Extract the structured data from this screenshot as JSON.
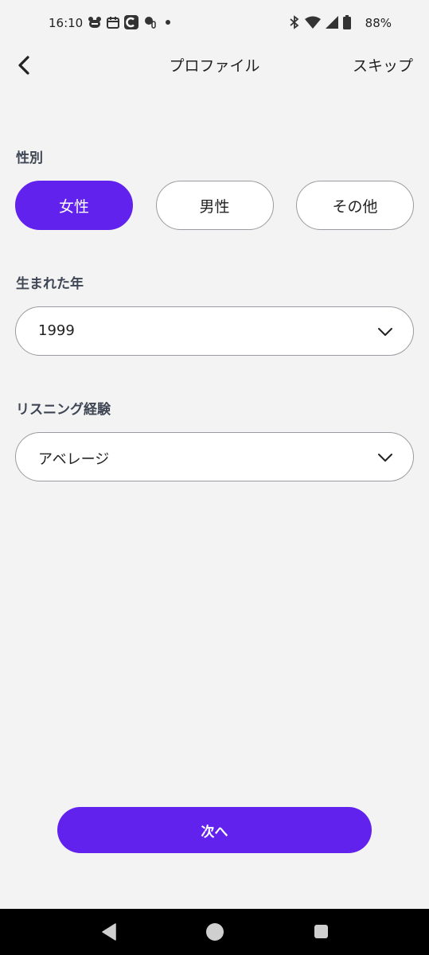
{
  "status_bar": {
    "time": "16:10",
    "battery": "88%",
    "left_icons": [
      "app-notification-icon",
      "calendar-icon",
      "c-app-icon",
      "accessibility-icon",
      "dot-icon"
    ],
    "right_icons": [
      "bluetooth-icon",
      "wifi-icon",
      "signal-icon",
      "battery-icon"
    ]
  },
  "header": {
    "back_icon": "back-chevron-icon",
    "title": "プロファイル",
    "skip_label": "スキップ"
  },
  "gender": {
    "label": "性別",
    "options": [
      "女性",
      "男性",
      "その他"
    ],
    "selected": "女性"
  },
  "birth_year": {
    "label": "生まれた年",
    "value": "1999"
  },
  "listening_experience": {
    "label": "リスニング経験",
    "value": "アベレージ"
  },
  "next_button": {
    "label": "次へ"
  },
  "colors": {
    "accent": "#6222ee",
    "background": "#f3f3f3"
  }
}
